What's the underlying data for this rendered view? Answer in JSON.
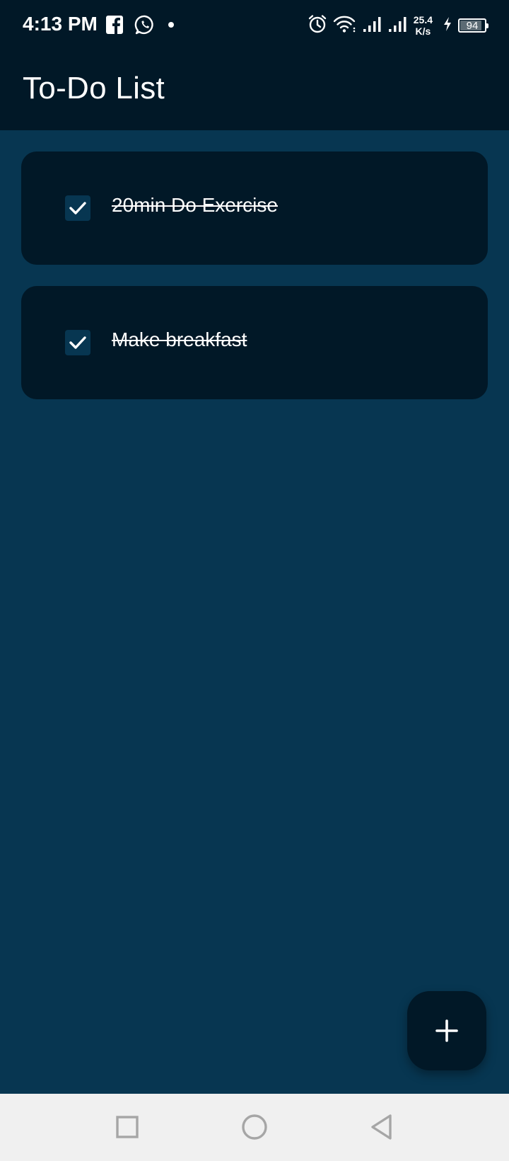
{
  "status_bar": {
    "time": "4:13 PM",
    "left_icons": [
      "facebook-icon",
      "whatsapp-icon",
      "dot-icon"
    ],
    "right_icons": [
      "alarm-icon",
      "wifi-icon",
      "signal-icon",
      "signal-icon",
      "charging-icon"
    ],
    "net_speed_value": "25.4",
    "net_speed_unit": "K/s",
    "battery_level": "94"
  },
  "app_bar": {
    "title": "To-Do List"
  },
  "tasks": [
    {
      "text": "20min Do Exercise",
      "checked": true
    },
    {
      "text": "Make breakfast",
      "checked": true
    }
  ],
  "fab": {
    "icon": "plus-icon"
  },
  "nav_bar": {
    "buttons": [
      "recent-apps-icon",
      "home-icon",
      "back-icon"
    ]
  },
  "colors": {
    "background": "#073651",
    "app_bar": "#011827",
    "card": "#011827",
    "nav_bar": "#f0f0f0"
  }
}
